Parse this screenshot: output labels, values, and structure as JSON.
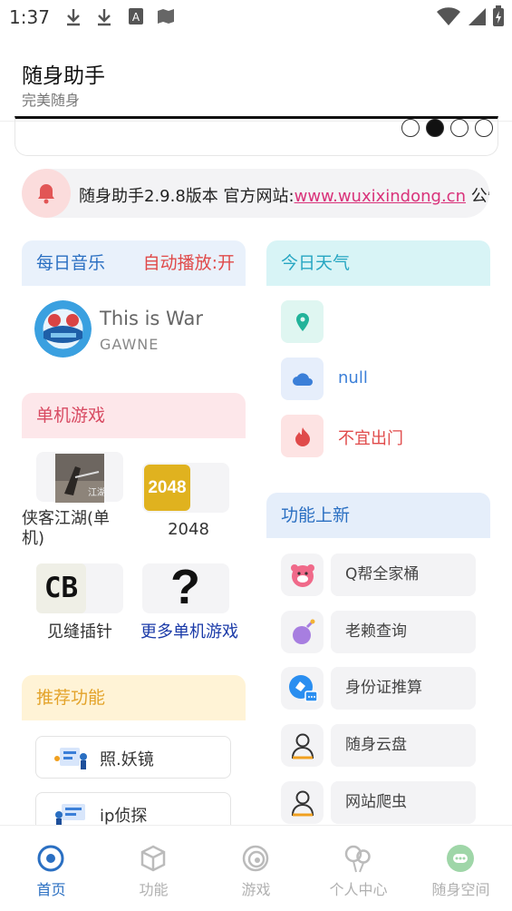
{
  "status_bar": {
    "time": "1:37"
  },
  "app": {
    "title": "随身助手",
    "subtitle": "完美随身"
  },
  "notice": {
    "text": "随身助手2.9.8版本 官方网站:",
    "link": "www.wuxixindong.cn",
    "tail": " 公告"
  },
  "music": {
    "header": "每日音乐",
    "autoplay": "自动播放:开",
    "song": "This is War",
    "artist": "GAWNE"
  },
  "weather": {
    "header": "今日天气",
    "items": [
      {
        "icon": "location-pin-icon",
        "text": "",
        "color": "#22b39a"
      },
      {
        "icon": "cloud-icon",
        "text": "null",
        "color": "#3b7fd8"
      },
      {
        "icon": "fire-icon",
        "text": "不宜出门",
        "color": "#e04a4a"
      }
    ]
  },
  "games": {
    "header": "单机游戏",
    "items": [
      {
        "label": "侠客江湖(单机)",
        "icon": "xiake-jianghu-game-icon"
      },
      {
        "label": "2048",
        "icon": "2048-game-icon",
        "tile_text": "2048"
      },
      {
        "label": "见缝插针",
        "icon": "cb-game-icon",
        "tile_text": "CB"
      },
      {
        "label": "更多单机游戏",
        "icon": "question-mark-icon",
        "tile_text": "?"
      }
    ]
  },
  "new_features": {
    "header": "功能上新",
    "items": [
      {
        "label": "Q帮全家桶",
        "icon": "pink-bear-icon"
      },
      {
        "label": "老赖查询",
        "icon": "purple-bomb-icon"
      },
      {
        "label": "身份证推算",
        "icon": "id-card-chat-icon"
      },
      {
        "label": "随身云盘",
        "icon": "user-icon"
      },
      {
        "label": "网站爬虫",
        "icon": "user-icon"
      }
    ]
  },
  "recommend": {
    "header": "推荐功能",
    "items": [
      {
        "label": "照.妖镜",
        "icon": "mirror-illustration-icon"
      },
      {
        "label": "ip侦探",
        "icon": "ip-detective-illustration-icon"
      }
    ]
  },
  "bottom_nav": [
    {
      "label": "首页",
      "icon": "home-target-icon",
      "active": true
    },
    {
      "label": "功能",
      "icon": "cube-icon",
      "active": false
    },
    {
      "label": "游戏",
      "icon": "spiral-icon",
      "active": false
    },
    {
      "label": "个人中心",
      "icon": "balloons-icon",
      "active": false
    },
    {
      "label": "随身空间",
      "icon": "chat-bubble-icon",
      "active": false
    }
  ],
  "colors": {
    "primary": "#2a6fc2",
    "link": "#d9327a",
    "warning": "#e04a4a"
  }
}
